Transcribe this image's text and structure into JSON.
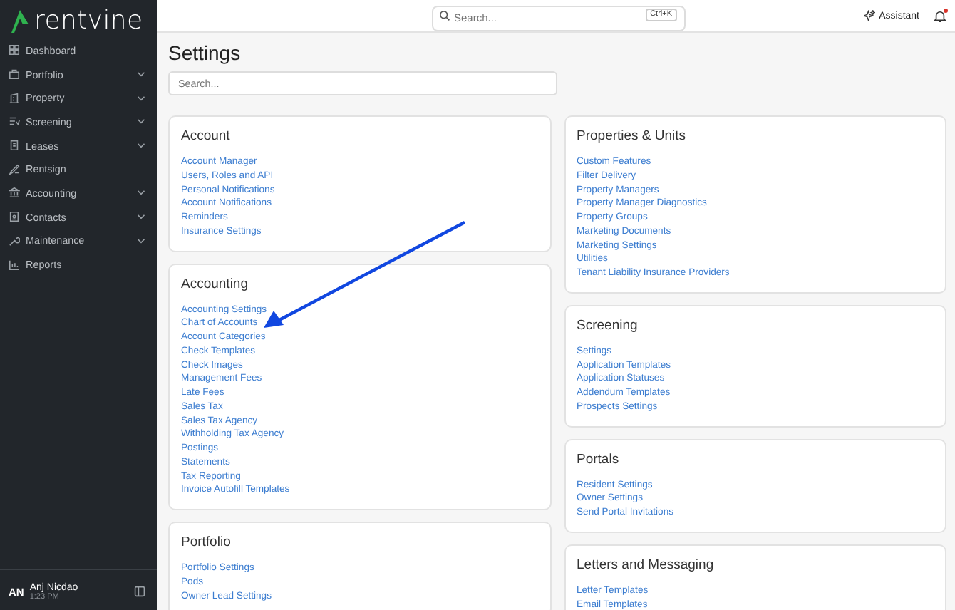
{
  "brand": {
    "name": "rentvine"
  },
  "sidebar": {
    "items": [
      {
        "label": "Dashboard",
        "has_submenu": false
      },
      {
        "label": "Portfolio",
        "has_submenu": true
      },
      {
        "label": "Property",
        "has_submenu": true
      },
      {
        "label": "Screening",
        "has_submenu": true
      },
      {
        "label": "Leases",
        "has_submenu": true
      },
      {
        "label": "Rentsign",
        "has_submenu": false
      },
      {
        "label": "Accounting",
        "has_submenu": true
      },
      {
        "label": "Contacts",
        "has_submenu": true
      },
      {
        "label": "Maintenance",
        "has_submenu": true
      },
      {
        "label": "Reports",
        "has_submenu": false
      }
    ],
    "user": {
      "initials": "AN",
      "name": "Anj Nicdao",
      "time": "1:23 PM"
    }
  },
  "topbar": {
    "search": {
      "placeholder": "Search...",
      "shortcut": "Ctrl+K"
    },
    "assistant": "Assistant",
    "notifications_unread": true
  },
  "page": {
    "title": "Settings",
    "search": {
      "placeholder": "Search..."
    }
  },
  "columns": [
    [
      {
        "title": "Account",
        "links": [
          "Account Manager",
          "Users, Roles and API",
          "Personal Notifications",
          "Account Notifications",
          "Reminders",
          "Insurance Settings"
        ]
      },
      {
        "title": "Accounting",
        "links": [
          "Accounting Settings",
          "Chart of Accounts",
          "Account Categories",
          "Check Templates",
          "Check Images",
          "Management Fees",
          "Late Fees",
          "Sales Tax",
          "Sales Tax Agency",
          "Withholding Tax Agency",
          "Postings",
          "Statements",
          "Tax Reporting",
          "Invoice Autofill Templates"
        ]
      },
      {
        "title": "Portfolio",
        "links": [
          "Portfolio Settings",
          "Pods",
          "Owner Lead Settings"
        ]
      }
    ],
    [
      {
        "title": "Properties & Units",
        "links": [
          "Custom Features",
          "Filter Delivery",
          "Property Managers",
          "Property Manager Diagnostics",
          "Property Groups",
          "Marketing Documents",
          "Marketing Settings",
          "Utilities",
          "Tenant Liability Insurance Providers"
        ]
      },
      {
        "title": "Screening",
        "links": [
          "Settings",
          "Application Templates",
          "Application Statuses",
          "Addendum Templates",
          "Prospects Settings"
        ]
      },
      {
        "title": "Portals",
        "links": [
          "Resident Settings",
          "Owner Settings",
          "Send Portal Invitations"
        ]
      },
      {
        "title": "Letters and Messaging",
        "links": [
          "Letter Templates",
          "Email Templates"
        ]
      }
    ]
  ]
}
